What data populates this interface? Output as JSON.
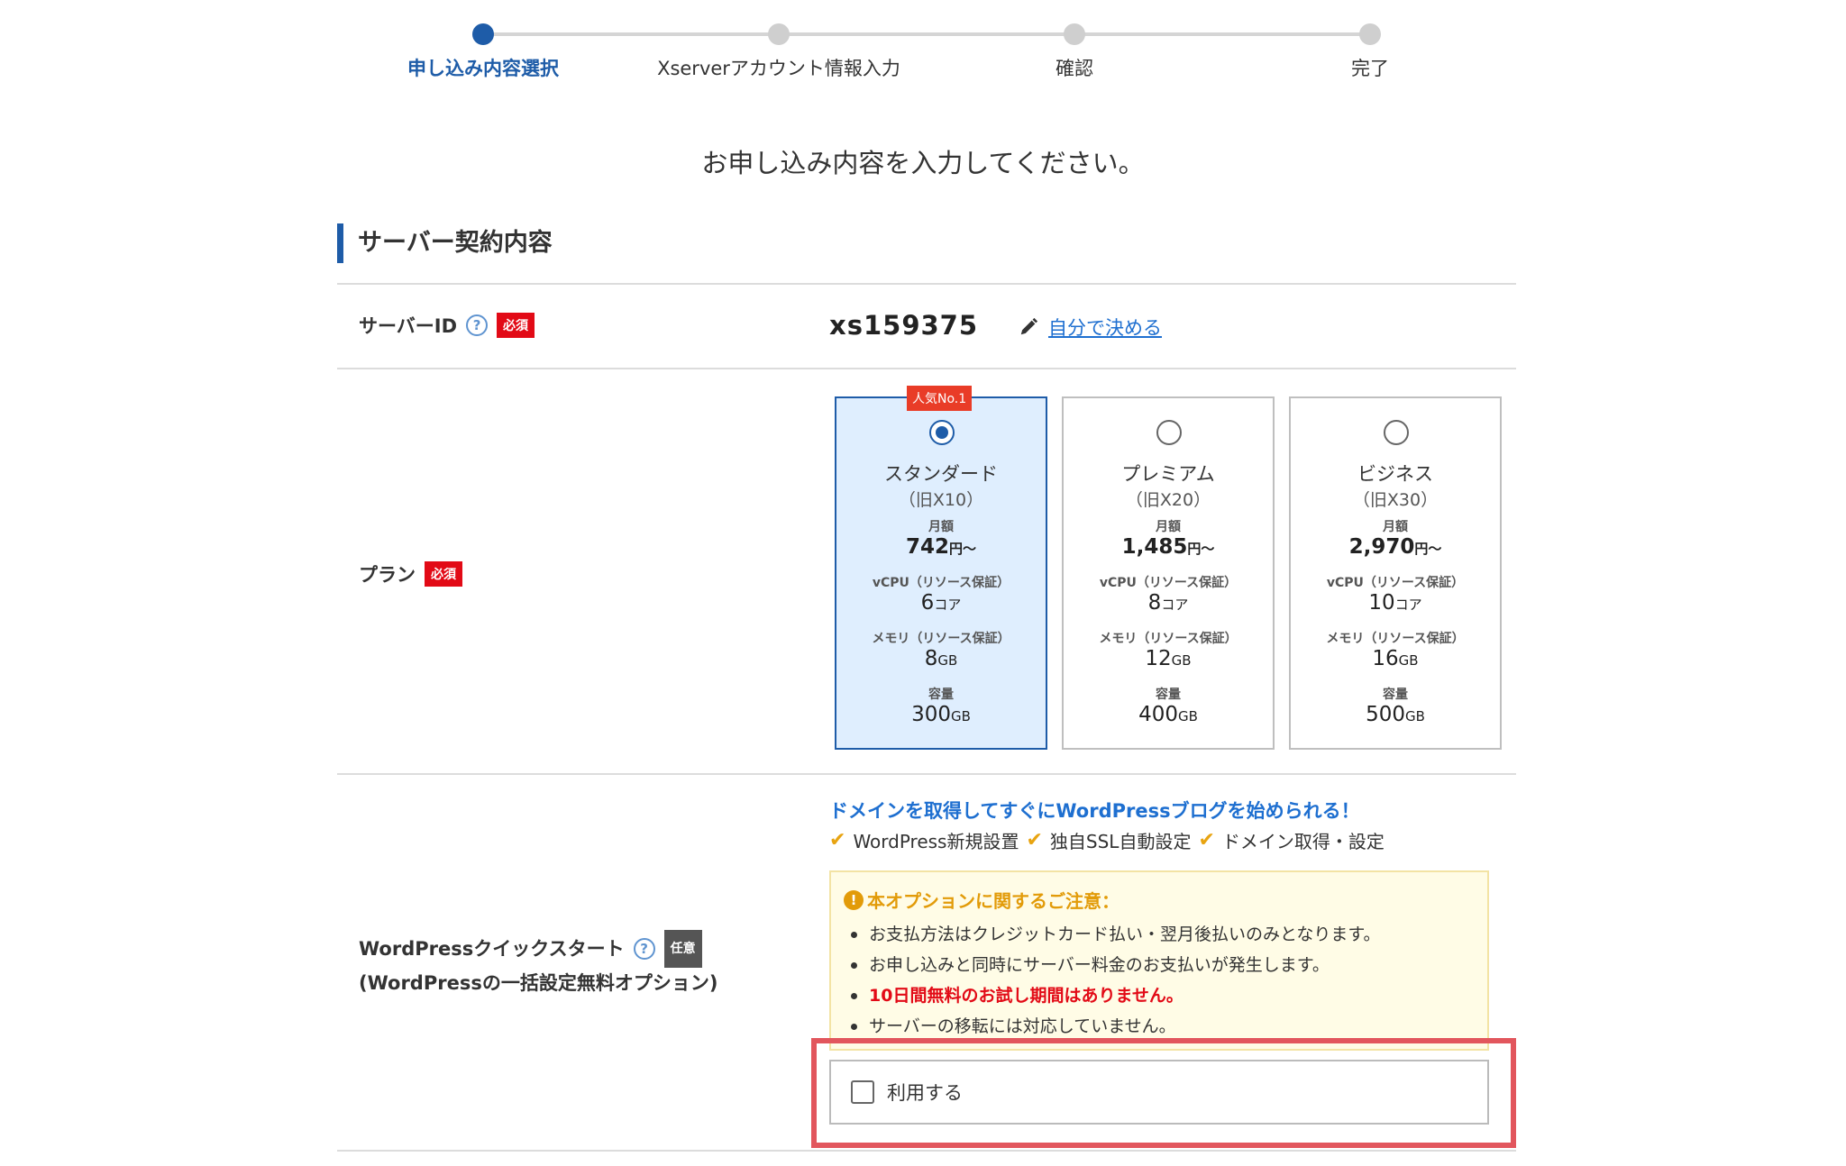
{
  "stepper": {
    "steps": [
      {
        "label": "申し込み内容選択",
        "active": true
      },
      {
        "label": "Xserverアカウント情報入力",
        "active": false
      },
      {
        "label": "確認",
        "active": false
      },
      {
        "label": "完了",
        "active": false
      }
    ]
  },
  "page": {
    "heading": "お申し込み内容を入力してください。",
    "section_title": "サーバー契約内容"
  },
  "server_id": {
    "label": "サーバーID",
    "help": "?",
    "badge": "必須",
    "value": "xs159375",
    "link": "自分で決める"
  },
  "plan": {
    "label": "プラン",
    "badge": "必須",
    "popular_badge": "人気No.1",
    "cards": [
      {
        "name": "スタンダード",
        "old_name": "（旧X10）",
        "price_label": "月額",
        "price": "742",
        "price_unit": "円〜",
        "vcpu_label": "vCPU（リソース保証）",
        "vcpu": "6",
        "vcpu_unit": "コア",
        "memory_label": "メモリ（リソース保証）",
        "memory": "8",
        "memory_unit": "GB",
        "storage_label": "容量",
        "storage": "300",
        "storage_unit": "GB",
        "selected": true
      },
      {
        "name": "プレミアム",
        "old_name": "（旧X20）",
        "price_label": "月額",
        "price": "1,485",
        "price_unit": "円〜",
        "vcpu_label": "vCPU（リソース保証）",
        "vcpu": "8",
        "vcpu_unit": "コア",
        "memory_label": "メモリ（リソース保証）",
        "memory": "12",
        "memory_unit": "GB",
        "storage_label": "容量",
        "storage": "400",
        "storage_unit": "GB",
        "selected": false
      },
      {
        "name": "ビジネス",
        "old_name": "（旧X30）",
        "price_label": "月額",
        "price": "2,970",
        "price_unit": "円〜",
        "vcpu_label": "vCPU（リソース保証）",
        "vcpu": "10",
        "vcpu_unit": "コア",
        "memory_label": "メモリ（リソース保証）",
        "memory": "16",
        "memory_unit": "GB",
        "storage_label": "容量",
        "storage": "500",
        "storage_unit": "GB",
        "selected": false
      }
    ]
  },
  "wordpress": {
    "label_line1": "WordPressクイックスタート",
    "label_line2": "(WordPressの一括設定無料オプション)",
    "help": "?",
    "badge": "任意",
    "headline": "ドメインを取得してすぐにWordPressブログを始められる！",
    "features": [
      "WordPress新規設置",
      "独自SSL自動設定",
      "ドメイン取得・設定"
    ],
    "notice_title": "本オプションに関するご注意：",
    "notice_icon": "!",
    "notices": [
      {
        "text": "お支払方法はクレジットカード払い・翌月後払いのみとなります。",
        "red": false
      },
      {
        "text": "お申し込みと同時にサーバー料金のお支払いが発生します。",
        "red": false
      },
      {
        "text": "10日間無料のお試し期間はありません。",
        "red": true
      },
      {
        "text": "サーバーの移転には対応していません。",
        "red": false
      }
    ],
    "use_label": "利用する",
    "use_checked": false
  },
  "colors": {
    "brand": "#1e5ca8",
    "required": "#e20a16",
    "link": "#1e6fd0",
    "highlight": "#e2565d",
    "warning": "#e29b09"
  }
}
